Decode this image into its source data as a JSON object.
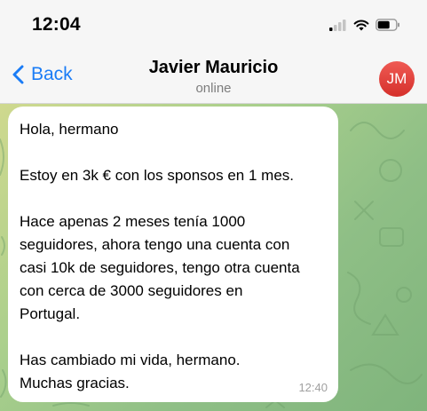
{
  "status_bar": {
    "time": "12:04",
    "icons": [
      "cellular-signal-icon",
      "wifi-icon",
      "battery-icon"
    ]
  },
  "nav": {
    "back_label": "Back",
    "contact_name": "Javier Mauricio",
    "contact_status": "online",
    "avatar_initials": "JM"
  },
  "message": {
    "paragraphs": [
      [
        "Hola, hermano"
      ],
      [
        "Estoy en 3k € con los sponsos en 1 mes."
      ],
      [
        "Hace apenas 2 meses tenía 1000",
        "seguidores, ahora tengo una cuenta con",
        "casi 10k de seguidores, tengo otra cuenta",
        "con cerca de 3000 seguidores en",
        "Portugal."
      ],
      [
        "Has cambiado mi vida, hermano.",
        "Muchas gracias."
      ]
    ],
    "time": "12:40"
  },
  "colors": {
    "accent": "#1a7cf6",
    "avatar": "#e0443e",
    "bubble": "#ffffff",
    "background_start": "#cfd98e",
    "background_end": "#7fb47c"
  }
}
